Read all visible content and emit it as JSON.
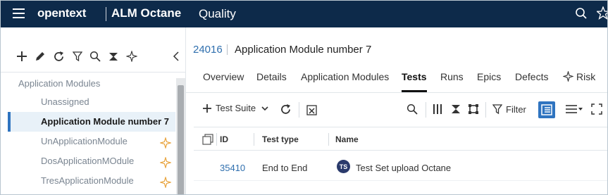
{
  "topbar": {
    "brand": "opentext",
    "product": "ALM Octane",
    "workspace": "Quality"
  },
  "left": {
    "tree_root": "Application Modules",
    "items": [
      {
        "label": "Unassigned",
        "selected": false,
        "starred": false
      },
      {
        "label": "Application Module number 7",
        "selected": true,
        "starred": false
      },
      {
        "label": "UnApplicationModule",
        "selected": false,
        "starred": true
      },
      {
        "label": "DosApplicationMOdule",
        "selected": false,
        "starred": true
      },
      {
        "label": "TresApplicationModule",
        "selected": false,
        "starred": true
      }
    ]
  },
  "breadcrumb": {
    "id": "24016",
    "title": "Application Module number 7"
  },
  "tabs": [
    "Overview",
    "Details",
    "Application Modules",
    "Tests",
    "Runs",
    "Epics",
    "Defects",
    "Risk"
  ],
  "active_tab": "Tests",
  "toolbar": {
    "test_suite_label": "Test Suite",
    "filter_label": "Filter"
  },
  "grid": {
    "columns": [
      "ID",
      "Test type",
      "Name"
    ],
    "rows": [
      {
        "id": "35410",
        "test_type": "End to End",
        "badge": "TS",
        "name": "Test Set upload Octane"
      }
    ]
  },
  "colors": {
    "topbar": "#0d2a4a",
    "accent": "#2f74c0",
    "link": "#2f6fae",
    "star": "#e8a33c",
    "selected_bg": "#e8f1f8"
  }
}
